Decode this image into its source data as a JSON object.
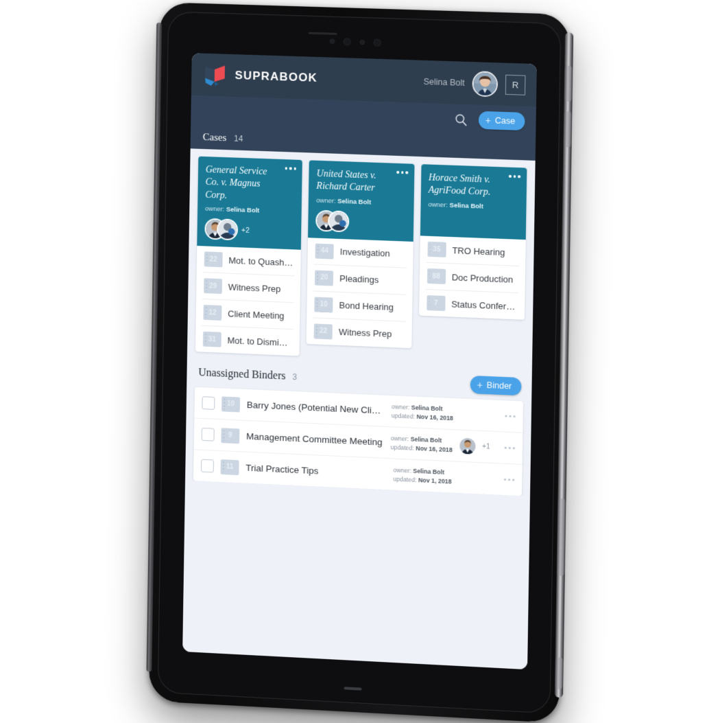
{
  "app": {
    "brand_name": "SUPRABOOK",
    "logo_icon": "suprabook-butterfly-logo"
  },
  "header": {
    "user_name": "Selina Bolt",
    "avatar_icon": "user-avatar",
    "role_badge": "R",
    "search_icon": "search-icon",
    "add_case_label": "Case",
    "add_case_plus": "+"
  },
  "cases_section": {
    "title": "Cases",
    "count": "14"
  },
  "cases": [
    {
      "title": "General Service Co. v. Magnus Corp.",
      "owner_label": "owner:",
      "owner": "Selina Bolt",
      "menu_icon": "more-options-icon",
      "avatars": [
        "member-avatar-1",
        "member-avatar-2"
      ],
      "avatar_more": "+2",
      "binders": [
        {
          "count": "22",
          "name": "Mot. to Quash ..."
        },
        {
          "count": "29",
          "name": "Witness Prep"
        },
        {
          "count": "12",
          "name": "Client Meeting"
        },
        {
          "count": "31",
          "name": "Mot. to Dismiss..."
        }
      ]
    },
    {
      "title": "United States v. Richard Carter",
      "owner_label": "owner:",
      "owner": "Selina Bolt",
      "menu_icon": "more-options-icon",
      "avatars": [
        "member-avatar-1",
        "member-avatar-2"
      ],
      "avatar_more": "",
      "binders": [
        {
          "count": "44",
          "name": "Investigation"
        },
        {
          "count": "20",
          "name": "Pleadings"
        },
        {
          "count": "10",
          "name": "Bond Hearing"
        },
        {
          "count": "22",
          "name": "Witness Prep"
        }
      ]
    },
    {
      "title": "Horace Smith v. AgriFood Corp.",
      "owner_label": "owner:",
      "owner": "Selina Bolt",
      "menu_icon": "more-options-icon",
      "avatars": [],
      "avatar_more": "",
      "binders": [
        {
          "count": "35",
          "name": "TRO Hearing"
        },
        {
          "count": "88",
          "name": "Doc Production"
        },
        {
          "count": "7",
          "name": "Status Confere..."
        }
      ]
    }
  ],
  "unassigned": {
    "title": "Unassigned Binders",
    "count": "3",
    "add_binder_label": "Binder",
    "add_binder_plus": "+",
    "rows": [
      {
        "count": "10",
        "name": "Barry Jones (Potential New Client)",
        "owner_label": "owner:",
        "owner": "Selina Bolt",
        "updated_label": "updated:",
        "updated": "Nov 16, 2018",
        "avatar": "",
        "avatar_more": "",
        "menu_icon": "more-options-icon"
      },
      {
        "count": "9",
        "name": "Management Committee Meeting",
        "owner_label": "owner:",
        "owner": "Selina Bolt",
        "updated_label": "updated:",
        "updated": "Nov 16, 2018",
        "avatar": "member-avatar-1",
        "avatar_more": "+1",
        "menu_icon": "more-options-icon"
      },
      {
        "count": "11",
        "name": "Trial Practice Tips",
        "owner_label": "owner:",
        "owner": "Selina Bolt",
        "updated_label": "updated:",
        "updated": "Nov 1, 2018",
        "avatar": "",
        "avatar_more": "",
        "menu_icon": "more-options-icon"
      }
    ]
  },
  "colors": {
    "header_dark": "#2f3e4e",
    "header_sub": "#33445a",
    "card_teal": "#1a7a96",
    "accent_blue": "#4aa3e8",
    "page_bg": "#eef1f7",
    "logo_red": "#ef4b52",
    "logo_navy": "#2f3e4e",
    "logo_blue": "#2e8bd0"
  }
}
